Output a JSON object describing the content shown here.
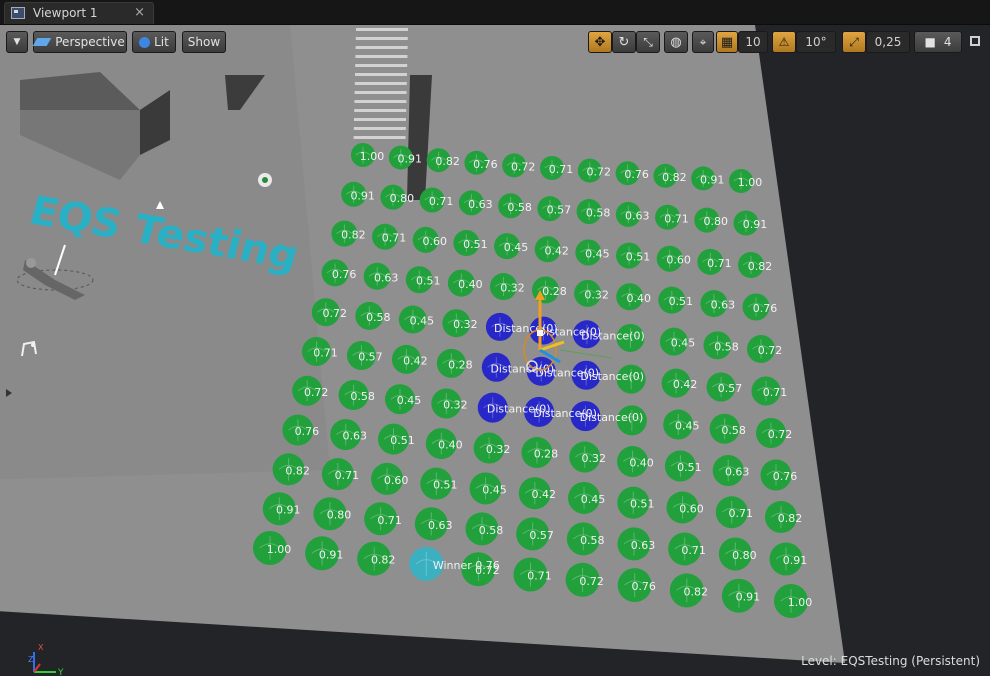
{
  "tab": {
    "title": "Viewport 1",
    "close": "×"
  },
  "toolbar": {
    "perspective_label": "Perspective",
    "lit_label": "Lit",
    "show_label": "Show",
    "grid_snap_value": "10",
    "rotation_snap_value": "10°",
    "scale_snap_value": "0,25",
    "camera_speed_value": "4"
  },
  "scene": {
    "title_text": "EQS Testing",
    "winner_label": "Winner",
    "distance_label": "Distance(0)",
    "rows": [
      [
        "1.00",
        "0.91",
        "0.82",
        "0.76",
        "0.72",
        "0.71",
        "0.72",
        "0.76",
        "0.82",
        "0.91",
        "1.00"
      ],
      [
        "0.91",
        "0.80",
        "0.71",
        "0.63",
        "0.58",
        "0.57",
        "0.58",
        "0.63",
        "0.71",
        "0.80",
        "0.91"
      ],
      [
        "0.82",
        "0.71",
        "0.60",
        "0.51",
        "0.45",
        "0.42",
        "0.45",
        "0.51",
        "0.60",
        "0.71",
        "0.82"
      ],
      [
        "0.76",
        "0.63",
        "0.51",
        "0.40",
        "0.32",
        "0.28",
        "0.32",
        "0.40",
        "0.51",
        "0.63",
        "0.76"
      ],
      [
        "0.72",
        "0.58",
        "0.45",
        "0.32",
        "",
        "",
        "",
        "",
        "0.45",
        "0.58",
        "0.72"
      ],
      [
        "0.71",
        "0.57",
        "0.42",
        "0.28",
        "",
        "",
        "",
        "",
        "0.42",
        "0.57",
        "0.71"
      ],
      [
        "0.72",
        "0.58",
        "0.45",
        "0.32",
        "",
        "",
        "",
        "",
        "0.45",
        "0.58",
        "0.72"
      ],
      [
        "0.76",
        "0.63",
        "0.51",
        "0.40",
        "0.32",
        "0.28",
        "0.32",
        "0.40",
        "0.51",
        "0.63",
        "0.76"
      ],
      [
        "0.82",
        "0.71",
        "0.60",
        "0.51",
        "0.45",
        "0.42",
        "0.45",
        "0.51",
        "0.60",
        "0.71",
        "0.82"
      ],
      [
        "0.91",
        "0.80",
        "0.71",
        "0.63",
        "0.58",
        "0.57",
        "0.58",
        "0.63",
        "0.71",
        "0.80",
        "0.91"
      ],
      [
        "1.00",
        "0.91",
        "0.82",
        "0.76",
        "0.72",
        "0.71",
        "0.72",
        "0.76",
        "0.82",
        "0.91",
        "1.00"
      ]
    ]
  },
  "axis": {
    "x": "X",
    "y": "Y",
    "z": "Z"
  },
  "status": {
    "level_text": "Level:  EQSTesting (Persistent)"
  },
  "colors": {
    "item_green": "#21a03c",
    "item_blue": "#2828c8",
    "winner": "#3ab0c0",
    "accent": "#e0a540"
  }
}
